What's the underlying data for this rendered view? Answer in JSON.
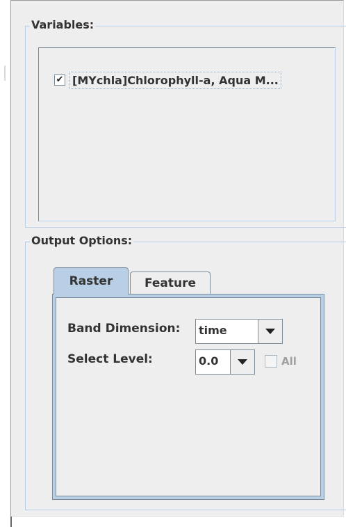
{
  "variables": {
    "title": "Variables:",
    "items": [
      {
        "label": "[MYchla]Chlorophyll-a, Aqua M...",
        "checked": true
      }
    ]
  },
  "output_options": {
    "title": "Output Options:",
    "tabs": [
      {
        "label": "Raster",
        "selected": true
      },
      {
        "label": "Feature",
        "selected": false
      }
    ],
    "band_dimension": {
      "label": "Band Dimension:",
      "value": "time"
    },
    "select_level": {
      "label": "Select Level:",
      "value": "0.0"
    },
    "all_checkbox": {
      "label": "All",
      "checked": false,
      "enabled": false
    }
  },
  "colors": {
    "panel_bg": "#eeeeee",
    "group_border": "#b8cfe5",
    "selected_tab": "#b8cfe5",
    "control_border": "#7a8a99"
  }
}
